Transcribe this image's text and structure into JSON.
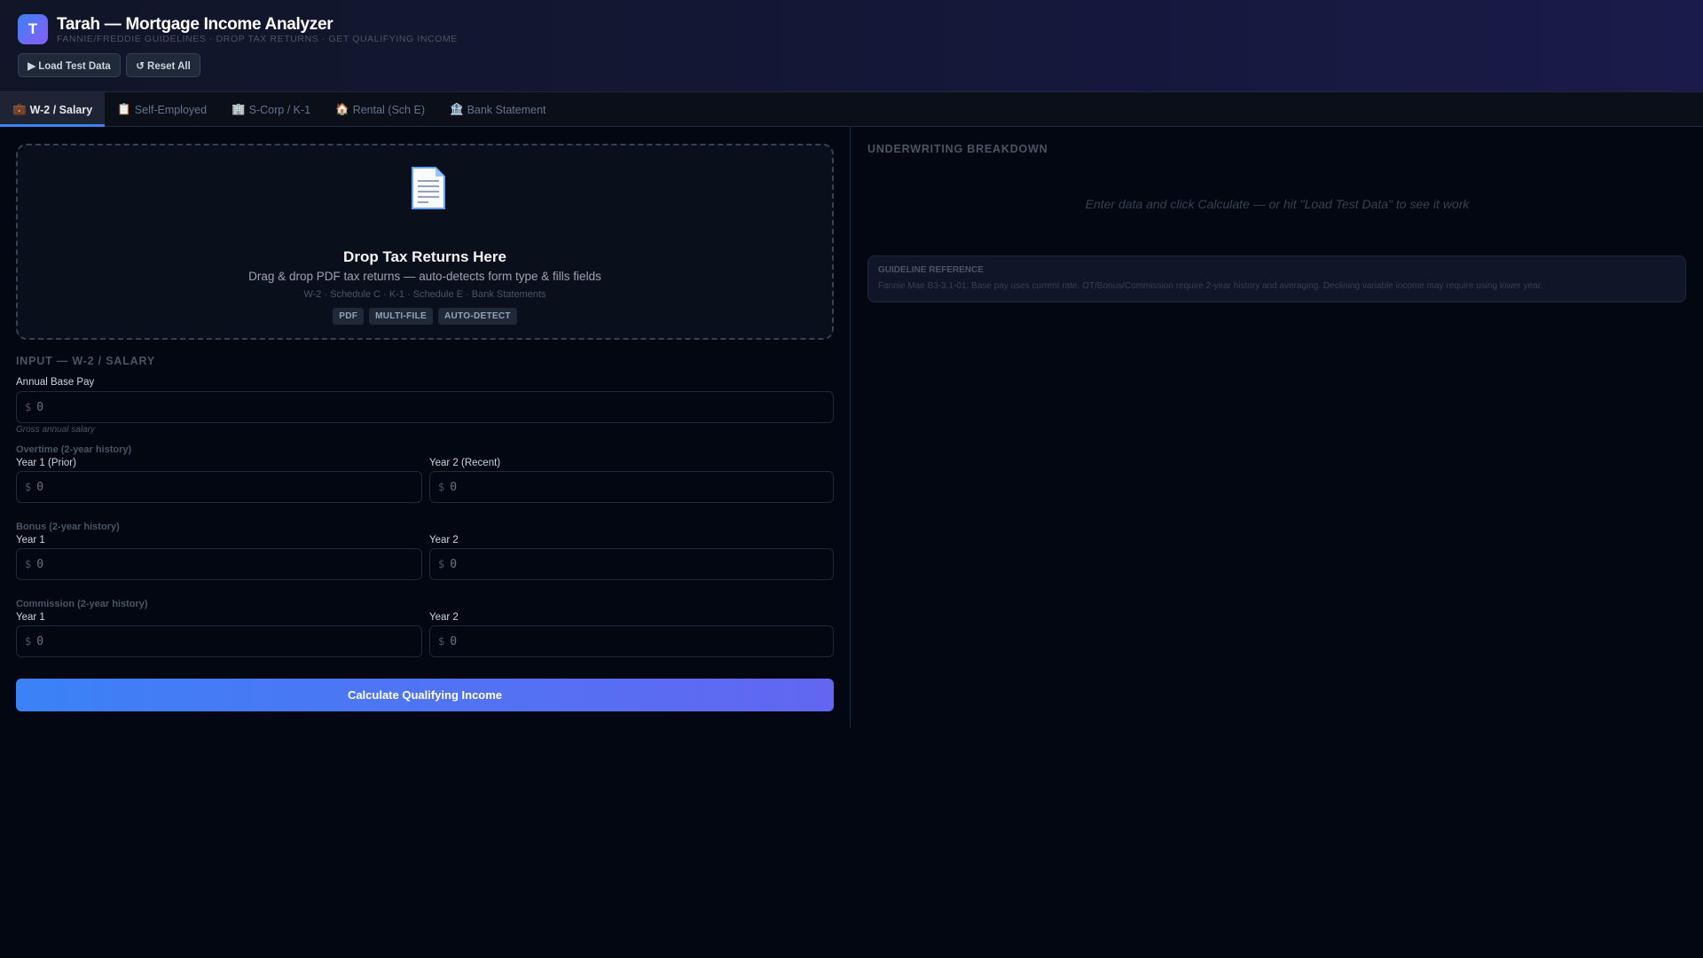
{
  "header": {
    "logo_letter": "T",
    "title": "Tarah — Mortgage Income Analyzer",
    "subtitle": "FANNIE/FREDDIE GUIDELINES · DROP TAX RETURNS · GET QUALIFYING INCOME",
    "load_test_label": "▶ Load Test Data",
    "reset_label": "↺ Reset All"
  },
  "tabs": [
    {
      "icon": "💼",
      "label": "W-2 / Salary"
    },
    {
      "icon": "📋",
      "label": "Self-Employed"
    },
    {
      "icon": "🏢",
      "label": "S-Corp / K-1"
    },
    {
      "icon": "🏠",
      "label": "Rental (Sch E)"
    },
    {
      "icon": "🏦",
      "label": "Bank Statement"
    }
  ],
  "dropzone": {
    "title": "Drop Tax Returns Here",
    "subtitle": "Drag & drop PDF tax returns — auto-detects form type & fills fields",
    "types": "W-2 · Schedule C · K-1 · Schedule E · Bank Statements",
    "chips": [
      "PDF",
      "MULTI-FILE",
      "AUTO-DETECT"
    ]
  },
  "form": {
    "section_title": "INPUT — W-2 / SALARY",
    "currency": "$",
    "base": {
      "label": "Annual Base Pay",
      "value": "0",
      "hint": "Gross annual salary"
    },
    "overtime": {
      "group": "Overtime (2-year history)",
      "y1_label": "Year 1 (Prior)",
      "y1": "0",
      "y2_label": "Year 2 (Recent)",
      "y2": "0"
    },
    "bonus": {
      "group": "Bonus (2-year history)",
      "y1_label": "Year 1",
      "y1": "0",
      "y2_label": "Year 2",
      "y2": "0"
    },
    "commission": {
      "group": "Commission (2-year history)",
      "y1_label": "Year 1",
      "y1": "0",
      "y2_label": "Year 2",
      "y2": "0"
    },
    "calculate_label": "Calculate Qualifying Income"
  },
  "breakdown": {
    "title": "UNDERWRITING BREAKDOWN",
    "empty": "Enter data and click Calculate — or hit \"Load Test Data\" to see it work",
    "guideline_title": "GUIDELINE REFERENCE",
    "guideline_text": "Fannie Mae B3-3.1-01: Base pay uses current rate. OT/Bonus/Commission require 2-year history and averaging. Declining variable income may require using lower year."
  }
}
